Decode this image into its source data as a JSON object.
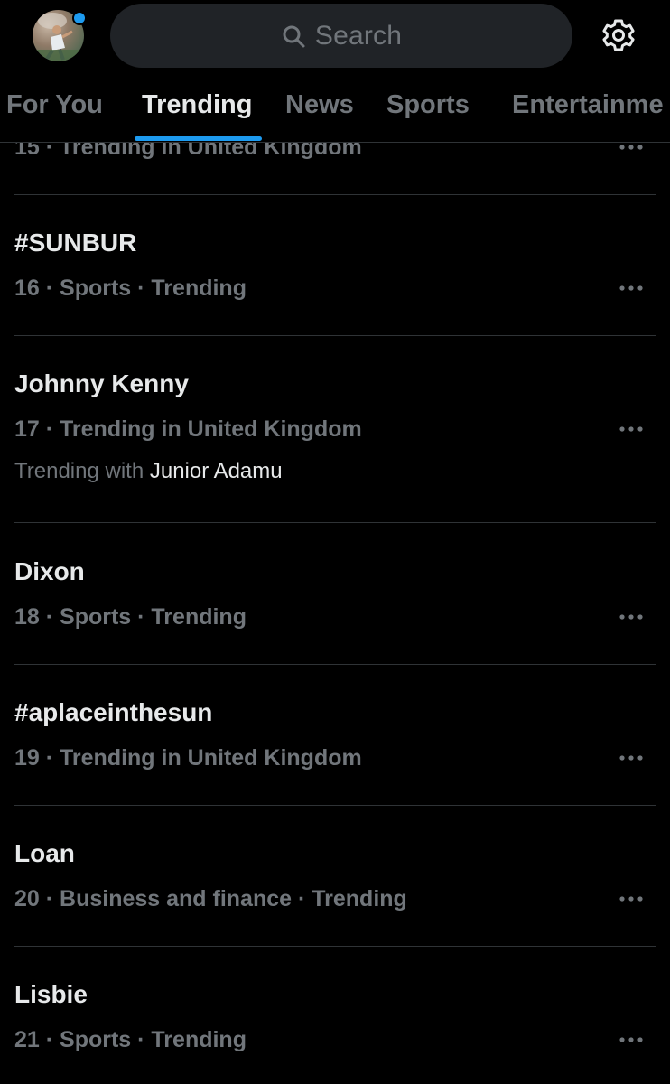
{
  "header": {
    "search_placeholder": "Search",
    "avatar_icon": "profile-avatar",
    "search_icon": "search-icon",
    "settings_icon": "gear-icon",
    "notification_dot_color": "#1d9bf0"
  },
  "tabs": [
    {
      "label": "For You",
      "active": false
    },
    {
      "label": "Trending",
      "active": true
    },
    {
      "label": "News",
      "active": false
    },
    {
      "label": "Sports",
      "active": false
    },
    {
      "label": "Entertainme",
      "active": false
    }
  ],
  "trends": [
    {
      "title": "",
      "meta": "15 · Trending in United Kingdom"
    },
    {
      "title": "#SUNBUR",
      "meta": "16 · Sports · Trending"
    },
    {
      "title": "Johnny Kenny",
      "meta": "17 · Trending in United Kingdom",
      "extra_prefix": "Trending with",
      "extra_name": "Junior Adamu"
    },
    {
      "title": "Dixon",
      "meta": "18 · Sports · Trending"
    },
    {
      "title": "#aplaceinthesun",
      "meta": "19 · Trending in United Kingdom"
    },
    {
      "title": "Loan",
      "meta": "20 · Business and finance · Trending"
    },
    {
      "title": "Lisbie",
      "meta": "21 · Sports · Trending"
    }
  ],
  "colors": {
    "background": "#000000",
    "accent": "#1d9bf0",
    "text_primary": "#e7e9ea",
    "text_secondary": "#71767b",
    "divider": "#2f3336",
    "search_bg": "#202327"
  }
}
